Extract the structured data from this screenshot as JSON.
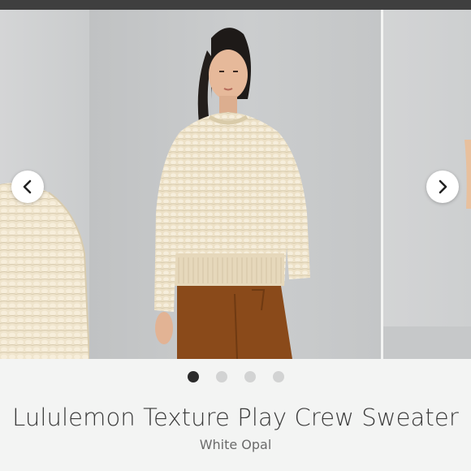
{
  "product": {
    "title": "Lululemon Texture Play Crew Sweater",
    "color_name": "White Opal"
  },
  "carousel": {
    "images": [
      {
        "icon": "sweater-closeup-image"
      },
      {
        "icon": "model-wearing-sweater-image"
      },
      {
        "icon": "model-side-view-image"
      }
    ],
    "current_index": 1,
    "prev_icon": "chevron-left-icon",
    "next_icon": "chevron-right-icon",
    "dots": [
      {
        "active": true
      },
      {
        "active": false
      },
      {
        "active": false
      },
      {
        "active": false
      }
    ]
  },
  "colors": {
    "sweater": "#eee2c8",
    "pants": "#8a4a1a",
    "background": "#c9cbcc",
    "active_dot": "#2b2b2b",
    "inactive_dot": "#d2d3d3"
  }
}
